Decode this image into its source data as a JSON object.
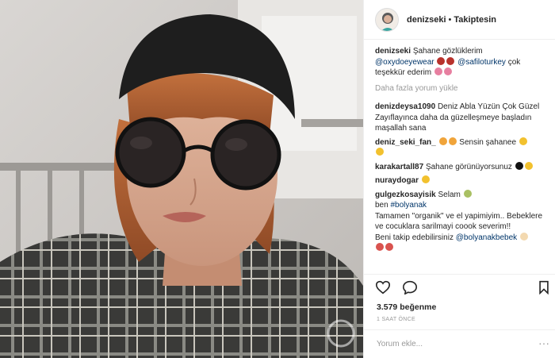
{
  "post": {
    "username": "denizseki",
    "separator": "•",
    "follow_state": "Takiptesin"
  },
  "caption": {
    "username": "denizseki",
    "text1": "Şahane gözlüklerim",
    "mention1": "@oxydoeyewear",
    "mention2": "@safiloturkey",
    "text2": "çok teşekkür ederim"
  },
  "load_more": "Daha fazla yorum yükle",
  "comments": [
    {
      "username": "denizdeysa1090",
      "text": "Deniz Abla Yüzün Çok Güzel Zayıflayınca daha da güzelleşmeye başladın maşallah sana"
    },
    {
      "username": "deniz_seki_fan_",
      "text": "Sensin şahanee"
    },
    {
      "username": "karakartall87",
      "text": "Şahane görünüyorsunuz"
    },
    {
      "username": "nuraydogar",
      "text": ""
    },
    {
      "username": "gulgezkosayisik",
      "text": "Selam",
      "line2_prefix": "ben",
      "hashtag": "#bolyanak",
      "line3": "Tamamen \"organik\" ve el yapimiyim.. Bebeklere ve cocuklara sarilmayi coook severim!!",
      "line4_prefix": "Beni takip edebilirsiniz",
      "mention": "@bolyanakbebek"
    }
  ],
  "likes": "3.579 beğenme",
  "time": "1 SAAT ÖNCE",
  "comment_placeholder": "Yorum ekle...",
  "more_options": "···",
  "icons": [
    "heart-icon",
    "comment-icon",
    "bookmark-icon"
  ],
  "colors": {
    "link": "#003569",
    "muted": "#999999",
    "text": "#262626"
  }
}
